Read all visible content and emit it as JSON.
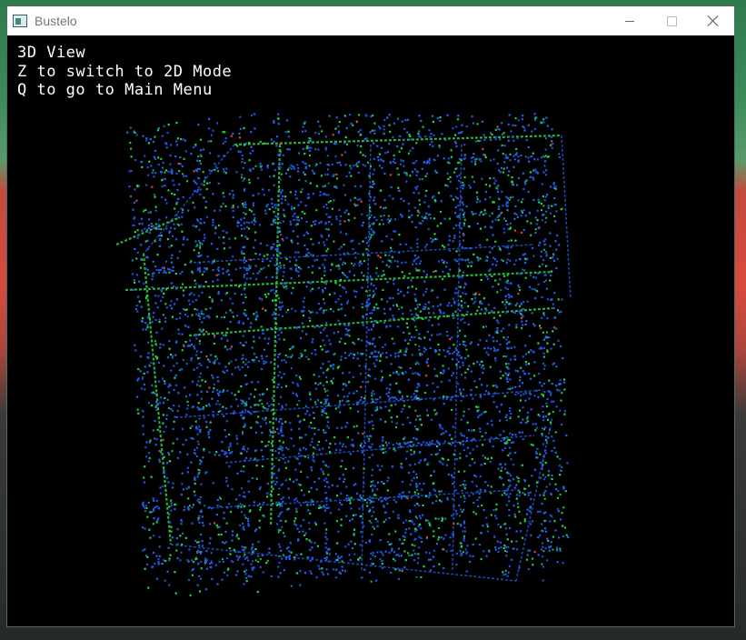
{
  "window": {
    "title": "Bustelo",
    "controls": {
      "minimize": "minimize",
      "maximize": "maximize",
      "close": "close"
    }
  },
  "hud": {
    "line1": "3D View",
    "line2": "Z to switch to 2D Mode",
    "line3": "Q to go to Main Menu"
  },
  "scene": {
    "background": "#000000",
    "point_colors": [
      "#1a4fd8",
      "#1f5ee8",
      "#2563e6",
      "#1ec83c",
      "#23d65a",
      "#d24a2a"
    ],
    "edge_color": "#2fd14a"
  }
}
